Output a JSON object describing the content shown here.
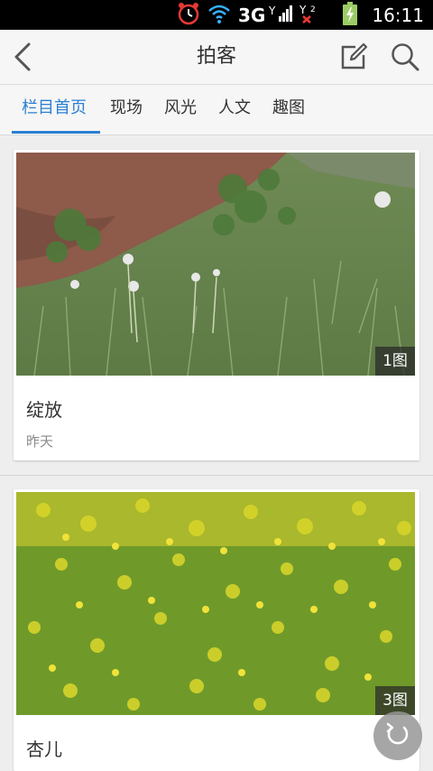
{
  "status_bar": {
    "network": "3G",
    "time": "16:11",
    "icons": [
      "alarm-icon",
      "wifi-icon",
      "signal-icon",
      "signal2-icon",
      "battery-icon"
    ]
  },
  "header": {
    "title": "拍客",
    "icons": [
      "back-arrow-icon",
      "edit-icon",
      "search-icon"
    ]
  },
  "tabs": [
    "栏目首页",
    "现场",
    "风光",
    "人文",
    "趣图"
  ],
  "active_tab": 0,
  "accent_color": "#2a7fd4",
  "cards": [
    {
      "title": "绽放",
      "date": "昨天",
      "image_count": "1图"
    },
    {
      "title": "杏儿",
      "date": "",
      "image_count": "3图"
    }
  ],
  "fab": {
    "icon": "refresh-icon"
  }
}
